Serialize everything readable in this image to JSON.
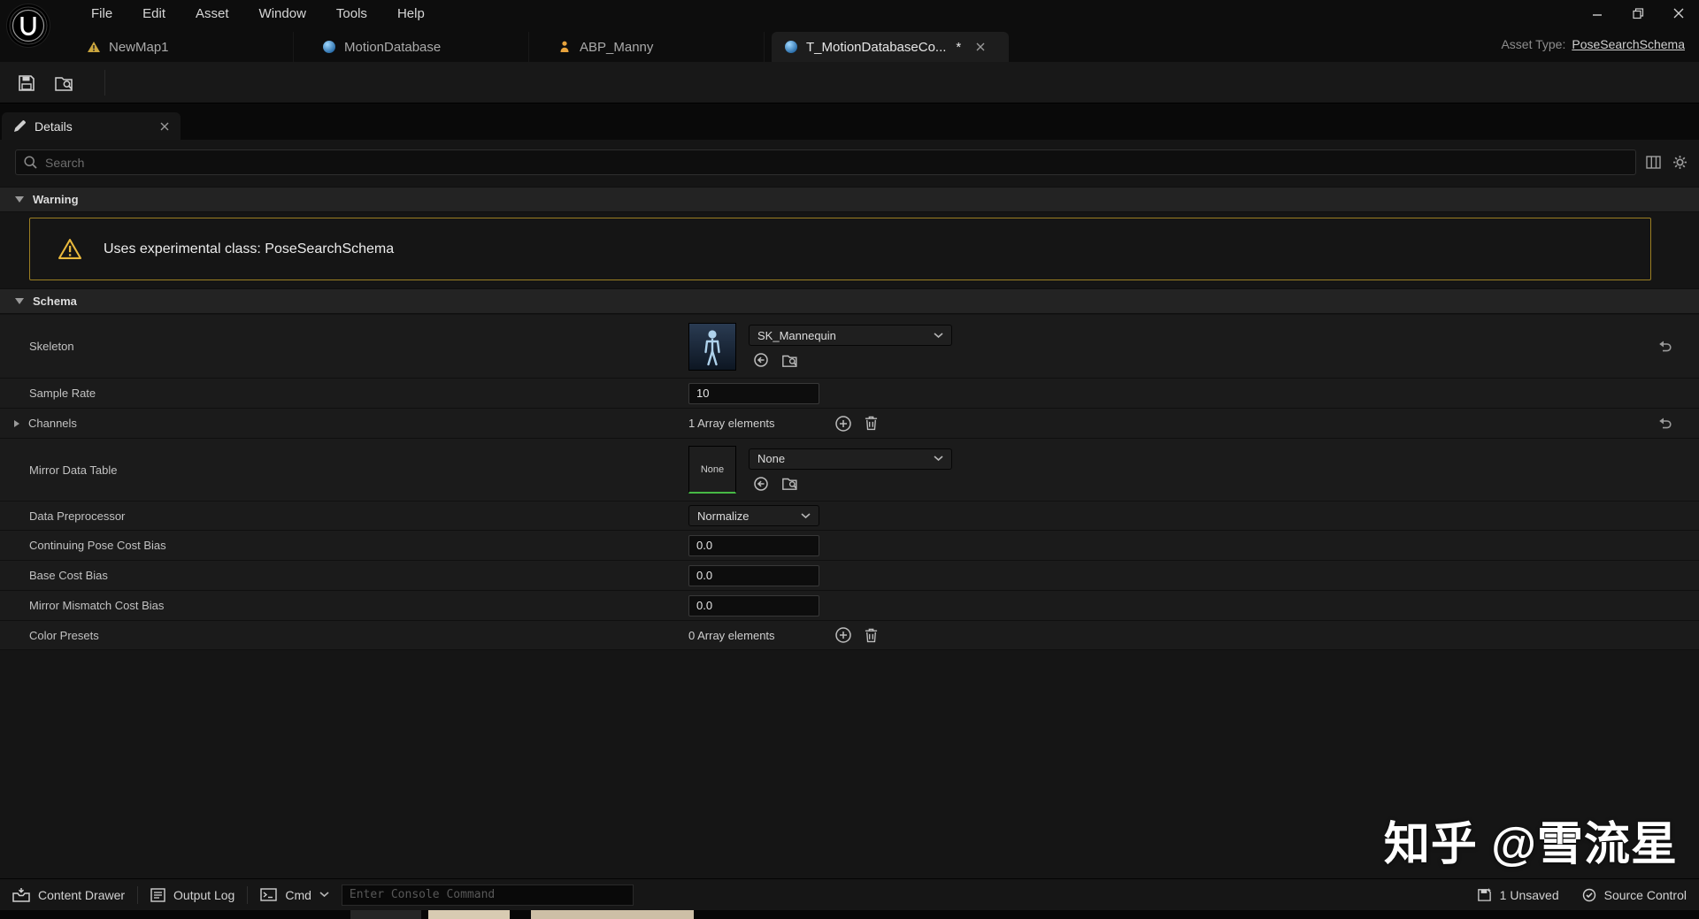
{
  "menubar": {
    "items": [
      "File",
      "Edit",
      "Asset",
      "Window",
      "Tools",
      "Help"
    ]
  },
  "header_right": {
    "asset_type_label": "Asset Type:",
    "asset_type_value": "PoseSearchSchema"
  },
  "tabs": {
    "items": [
      {
        "label": "NewMap1"
      },
      {
        "label": "MotionDatabase"
      },
      {
        "label": "ABP_Manny"
      },
      {
        "label": "T_MotionDatabaseCo...",
        "modified": "*"
      }
    ]
  },
  "details_panel": {
    "tab_label": "Details",
    "search_placeholder": "Search",
    "warning_section": {
      "title": "Warning",
      "message": "Uses experimental class: PoseSearchSchema"
    },
    "schema_section": {
      "title": "Schema",
      "rows": {
        "skeleton": {
          "label": "Skeleton",
          "value": "SK_Mannequin"
        },
        "sample_rate": {
          "label": "Sample Rate",
          "value": "10"
        },
        "channels": {
          "label": "Channels",
          "value": "1 Array elements"
        },
        "mirror_data_table": {
          "label": "Mirror Data Table",
          "thumb_text": "None",
          "value": "None"
        },
        "data_preprocessor": {
          "label": "Data Preprocessor",
          "value": "Normalize"
        },
        "continuing_pose_cost_bias": {
          "label": "Continuing Pose Cost Bias",
          "value": "0.0"
        },
        "base_cost_bias": {
          "label": "Base Cost Bias",
          "value": "0.0"
        },
        "mirror_mismatch_cost_bias": {
          "label": "Mirror Mismatch Cost Bias",
          "value": "0.0"
        },
        "color_presets": {
          "label": "Color Presets",
          "value": "0 Array elements"
        }
      }
    }
  },
  "statusbar": {
    "content_drawer": "Content Drawer",
    "output_log": "Output Log",
    "cmd": "Cmd",
    "console_placeholder": "Enter Console Command",
    "unsaved": "1 Unsaved",
    "source_control": "Source Control"
  },
  "watermark": "知乎 @雪流星",
  "colors": {
    "warning_yellow": "#d9a72c",
    "accent_green": "#47b945",
    "icon_blue": "#4aa3e0",
    "abp_orange": "#e8a33c"
  }
}
